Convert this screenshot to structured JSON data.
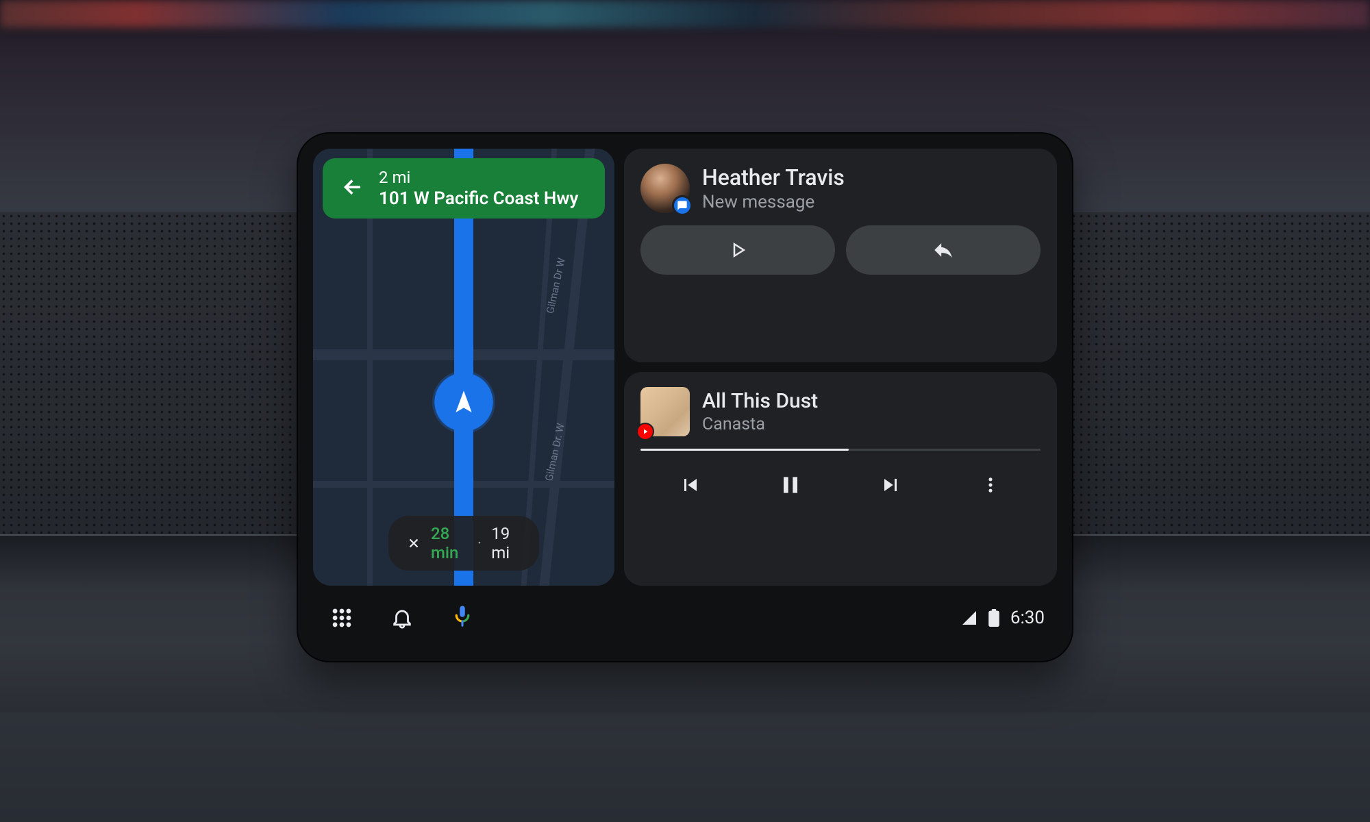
{
  "notification": {
    "sender": "Heather Travis",
    "subtitle": "New message",
    "app_icon": "messages-icon"
  },
  "media": {
    "track": "All This Dust",
    "artist": "Canasta",
    "source_icon": "youtube-music-icon",
    "progress_pct": 52
  },
  "navigation": {
    "maneuver": "turn-left",
    "distance": "2 mi",
    "road": "101 W Pacific Coast Hwy",
    "eta_duration": "28 min",
    "eta_distance": "19 mi",
    "street_labels": [
      "Gilman Dr W",
      "Gilman Dr. W"
    ]
  },
  "statusbar": {
    "time": "6:30"
  },
  "colors": {
    "nav_banner": "#188038",
    "route": "#1a73e8",
    "eta_time": "#34a853",
    "card_bg": "#202124"
  }
}
